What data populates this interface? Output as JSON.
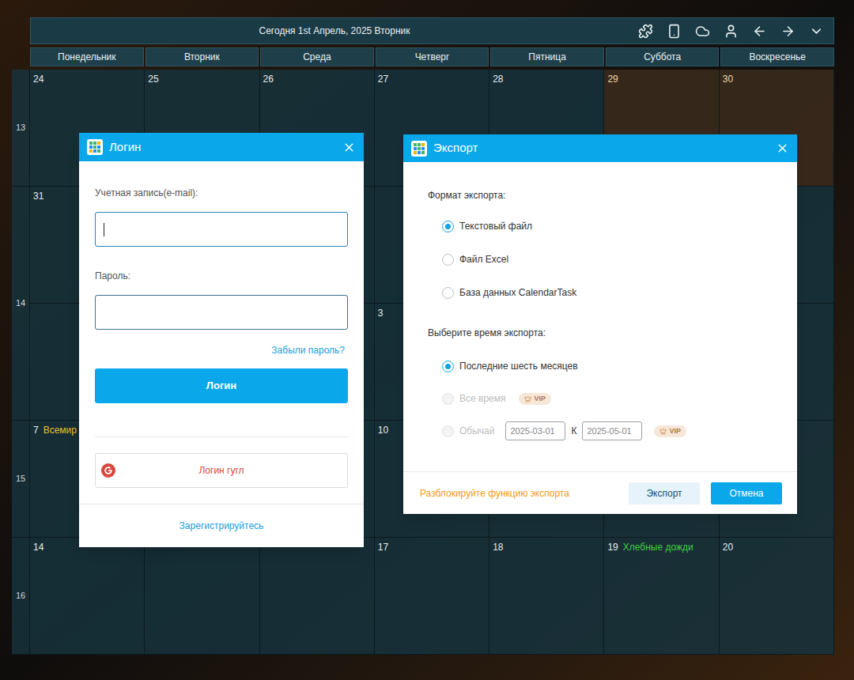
{
  "calendar": {
    "today": "Сегодня 1st Апрель, 2025 Вторник",
    "weekdays": [
      "Понедельник",
      "Вторник",
      "Среда",
      "Четверг",
      "Пятница",
      "Суббота",
      "Воскресенье"
    ],
    "weeks": [
      {
        "label": "13",
        "rows": [
          [
            {
              "day": "24",
              "past": true,
              "weekend": false
            },
            {
              "day": "25",
              "past": true,
              "weekend": false
            },
            {
              "day": "26",
              "past": true,
              "weekend": false
            },
            {
              "day": "27",
              "past": true,
              "weekend": false
            },
            {
              "day": "28",
              "past": true,
              "weekend": false
            },
            {
              "day": "29",
              "past": true,
              "weekend": true
            },
            {
              "day": "30",
              "past": true,
              "weekend": true
            }
          ]
        ]
      },
      {
        "label": "14",
        "rows": [
          [
            {
              "day": "31",
              "past": true,
              "weekend": false
            },
            {
              "day": "",
              "past": false,
              "weekend": false
            },
            {
              "day": "",
              "past": false,
              "weekend": false
            },
            {
              "day": "",
              "past": false,
              "weekend": false
            },
            {
              "day": "",
              "past": false,
              "weekend": false
            },
            {
              "day": "",
              "past": false,
              "weekend": true
            },
            {
              "day": "",
              "past": false,
              "weekend": true
            }
          ],
          [
            {
              "day": "",
              "past": false,
              "weekend": false
            },
            {
              "day": "",
              "past": false,
              "weekend": false
            },
            {
              "day": "",
              "past": false,
              "weekend": false
            },
            {
              "day": "3",
              "past": false,
              "weekend": false
            },
            {
              "day": "",
              "past": false,
              "weekend": false
            },
            {
              "day": "",
              "past": false,
              "weekend": true
            },
            {
              "day": "",
              "past": false,
              "weekend": true
            }
          ]
        ]
      },
      {
        "label": "15",
        "rows": [
          [
            {
              "day": "7",
              "past": false,
              "weekend": false,
              "event": {
                "text": "Всемир",
                "color": "#e6c229"
              }
            },
            {
              "day": "",
              "past": false,
              "weekend": false
            },
            {
              "day": "",
              "past": false,
              "weekend": false
            },
            {
              "day": "10",
              "past": false,
              "weekend": false
            },
            {
              "day": "",
              "past": false,
              "weekend": false
            },
            {
              "day": "",
              "past": false,
              "weekend": true
            },
            {
              "day": "",
              "past": false,
              "weekend": true
            }
          ]
        ]
      },
      {
        "label": "16",
        "rows": [
          [
            {
              "day": "14",
              "past": false,
              "weekend": false
            },
            {
              "day": "",
              "past": false,
              "weekend": false
            },
            {
              "day": "",
              "past": false,
              "weekend": false
            },
            {
              "day": "17",
              "past": false,
              "weekend": false
            },
            {
              "day": "18",
              "past": false,
              "weekend": false
            },
            {
              "day": "19",
              "past": false,
              "weekend": true,
              "event": {
                "text": "Хлебные дожди",
                "color": "#3fcf3f"
              }
            },
            {
              "day": "20",
              "past": false,
              "weekend": true
            }
          ]
        ]
      }
    ]
  },
  "login": {
    "title": "Логин",
    "email_label": "Учетная запись(e-mail):",
    "email_focused": true,
    "password_label": "Пароль:",
    "password_focused": false,
    "forgot": "Забыли пароль?",
    "submit": "Логин",
    "google": "Логин гугл",
    "register": "Зарегистрируйтесь"
  },
  "export": {
    "title": "Экспорт",
    "format_label": "Формат экспорта:",
    "formats": [
      {
        "label": "Текстовый файл",
        "selected": true
      },
      {
        "label": "Файл Excel",
        "selected": false
      },
      {
        "label": "База данных CalendarTask",
        "selected": false
      }
    ],
    "time_label": "Выберите время экспорта:",
    "ranges": [
      {
        "kind": "plain",
        "label": "Последние шесть месяцев",
        "selected": true,
        "disabled": false
      },
      {
        "kind": "vip",
        "label": "Все время",
        "selected": false,
        "disabled": true,
        "badge": "VIP"
      },
      {
        "kind": "custom",
        "label": "Обычай",
        "selected": false,
        "disabled": true,
        "from": "2025-03-01",
        "separator": "К",
        "to": "2025-05-01",
        "badge": "VIP"
      }
    ],
    "unlock": "Разблокируйте функцию экспорта",
    "buttons": [
      {
        "label": "Экспорт",
        "primary": false
      },
      {
        "label": "Отмена",
        "primary": true
      }
    ]
  }
}
